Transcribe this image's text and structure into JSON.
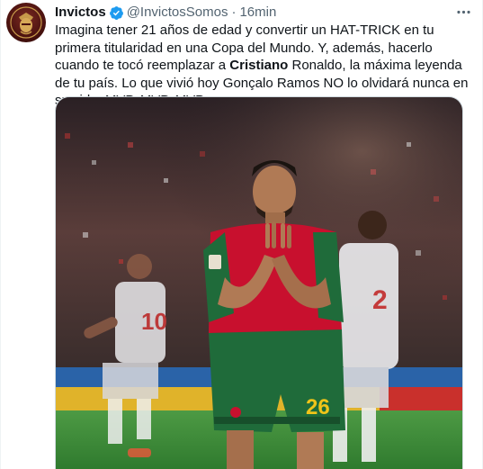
{
  "author": {
    "name": "Invictos",
    "handle": "@InvictosSomos",
    "separator": "·",
    "time": "16min",
    "verified": true
  },
  "tweet": {
    "text_1": "Imagina tener 21 años de edad y convertir un HAT-TRICK en tu primera titularidad en una Copa del Mundo. Y, además, hacerlo cuando te tocó reemplazar a ",
    "bold": "Cristiano",
    "text_2": " Ronaldo, la máxima leyenda de tu país. Lo que vivió hoy Gonçalo Ramos NO lo olvidará nunca en su vida. MVP. MVP. MVP."
  },
  "media": {
    "player_number": "26",
    "opponent_number_left": "10",
    "opponent_number_right": "2"
  },
  "colors": {
    "accent": "#1d9bf0",
    "secondary_text": "#536471",
    "portugal_red": "#c8102e",
    "portugal_green": "#1f6b3a",
    "pitch_green": "#3f8f3a"
  },
  "icons": {
    "verified": "verified-badge-icon",
    "more": "more-horizontal-icon"
  }
}
